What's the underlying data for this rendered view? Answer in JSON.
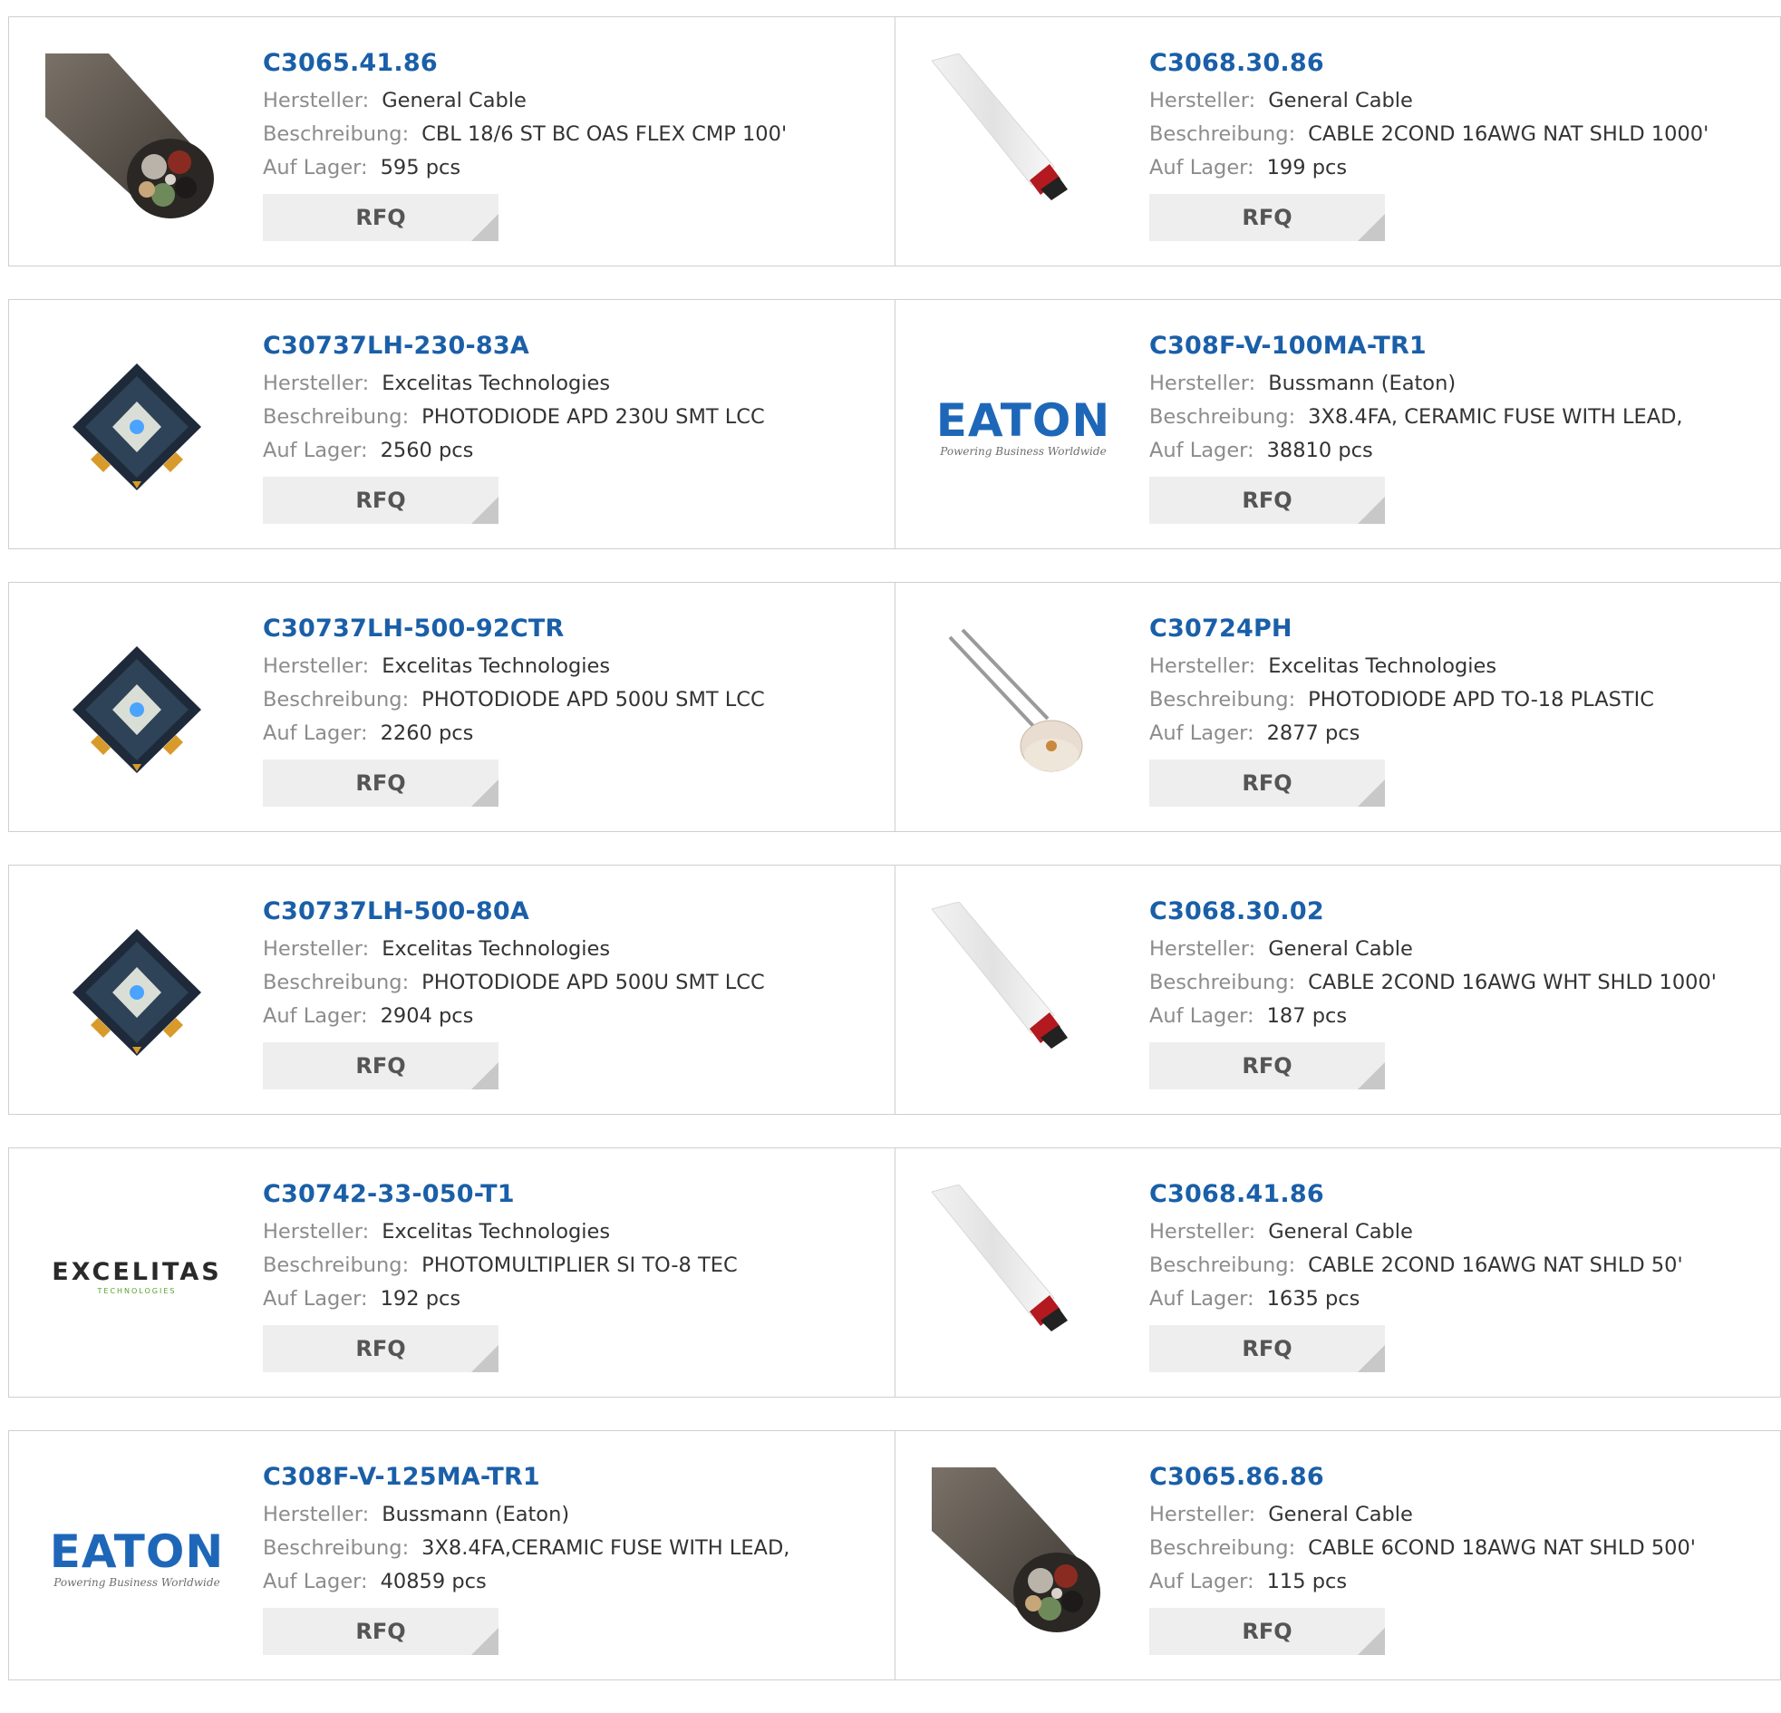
{
  "labels": {
    "manufacturer": "Hersteller:",
    "description": "Beschreibung:",
    "stock": "Auf Lager:",
    "rfq": "RFQ"
  },
  "colors": {
    "part_number": "#1a5fa8",
    "label": "#8c8c8c",
    "value": "#333333",
    "rfq_bg": "#eeeeee",
    "border": "#cfcfcf"
  },
  "products": [
    {
      "pn": "C3065.41.86",
      "manufacturer": "General Cable",
      "description": "CBL 18/6 ST BC OAS FLEX CMP 100'",
      "stock": "595 pcs",
      "image": "multi-conductor-cable-photo"
    },
    {
      "pn": "C3068.30.86",
      "manufacturer": "General Cable",
      "description": "CABLE 2COND 16AWG NAT SHLD 1000'",
      "stock": "199 pcs",
      "image": "white-cable-photo"
    },
    {
      "pn": "C30737LH-230-83A",
      "manufacturer": "Excelitas Technologies",
      "description": "PHOTODIODE APD 230U SMT LCC",
      "stock": "2560 pcs",
      "image": "smt-photodiode-photo"
    },
    {
      "pn": "C308F-V-100MA-TR1",
      "manufacturer": "Bussmann (Eaton)",
      "description": "3X8.4FA, CERAMIC FUSE WITH LEAD,",
      "stock": "38810 pcs",
      "image": "eaton-logo",
      "logo_text": "EATON",
      "logo_tagline": "Powering Business Worldwide"
    },
    {
      "pn": "C30737LH-500-92CTR",
      "manufacturer": "Excelitas Technologies",
      "description": "PHOTODIODE APD 500U SMT LCC",
      "stock": "2260 pcs",
      "image": "smt-photodiode-photo"
    },
    {
      "pn": "C30724PH",
      "manufacturer": "Excelitas Technologies",
      "description": "PHOTODIODE APD TO-18 PLASTIC",
      "stock": "2877 pcs",
      "image": "to18-photodiode-photo"
    },
    {
      "pn": "C30737LH-500-80A",
      "manufacturer": "Excelitas Technologies",
      "description": "PHOTODIODE APD 500U SMT LCC",
      "stock": "2904 pcs",
      "image": "smt-photodiode-photo"
    },
    {
      "pn": "C3068.30.02",
      "manufacturer": "General Cable",
      "description": "CABLE 2COND 16AWG WHT SHLD 1000'",
      "stock": "187 pcs",
      "image": "white-cable-photo"
    },
    {
      "pn": "C30742-33-050-T1",
      "manufacturer": "Excelitas Technologies",
      "description": "PHOTOMULTIPLIER SI TO-8 TEC",
      "stock": "192 pcs",
      "image": "excelitas-logo",
      "logo_text": "EXCELITAS",
      "logo_tagline": "TECHNOLOGIES"
    },
    {
      "pn": "C3068.41.86",
      "manufacturer": "General Cable",
      "description": "CABLE 2COND 16AWG NAT SHLD 50'",
      "stock": "1635 pcs",
      "image": "white-cable-photo"
    },
    {
      "pn": "C308F-V-125MA-TR1",
      "manufacturer": "Bussmann (Eaton)",
      "description": "3X8.4FA,CERAMIC FUSE WITH LEAD,",
      "stock": "40859 pcs",
      "image": "eaton-logo",
      "logo_text": "EATON",
      "logo_tagline": "Powering Business Worldwide"
    },
    {
      "pn": "C3065.86.86",
      "manufacturer": "General Cable",
      "description": "CABLE 6COND 18AWG NAT SHLD 500'",
      "stock": "115 pcs",
      "image": "multi-conductor-cable-photo"
    }
  ]
}
